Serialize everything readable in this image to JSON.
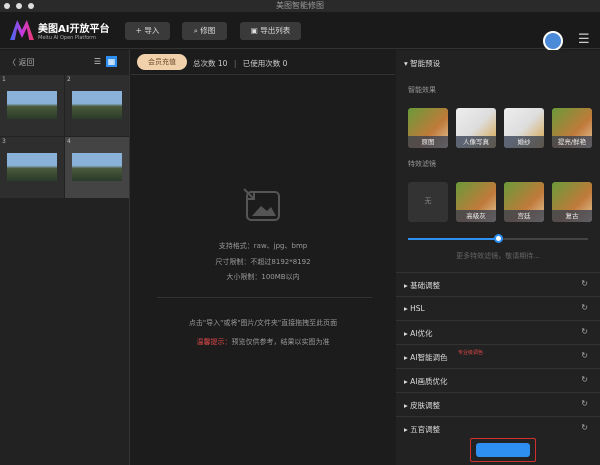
{
  "window": {
    "title": "美图智能修图"
  },
  "header": {
    "brand_title": "美图AI开放平台",
    "brand_subtitle": "Meitu AI Open Platform",
    "import_label": "+ 导入",
    "edit_label": "⌕ 修图",
    "export_list_label": "▣ 导出列表"
  },
  "left": {
    "back_label": "〈 返回",
    "thumbs": [
      {
        "num": "1"
      },
      {
        "num": "2"
      },
      {
        "num": "3"
      },
      {
        "num": "4"
      }
    ]
  },
  "center": {
    "vip_label": "会员充值",
    "total_label": "总次数 10",
    "sep": "|",
    "used_label": "已使用次数 0",
    "format": "支持格式：raw、jpg、bmp",
    "size_limit": "尺寸限制：不超过8192*8192",
    "file_limit": "大小限制：100MB以内",
    "drag_hint": "点击\"导入\"或将\"图片/文件夹\"直接拖拽至此页面",
    "tip_label": "温馨提示：",
    "tip_text": "预览仅供参考，结果以实图为准"
  },
  "right": {
    "preset_title": "智能预设",
    "smart_effects_title": "智能效果",
    "smart_effects": [
      "原图",
      "人像写真",
      "婚纱",
      "提亮/鲜艳"
    ],
    "filters_title": "特效滤镜",
    "filters": [
      "无",
      "高级灰",
      "宫廷",
      "复古"
    ],
    "filter_strength": 0.5,
    "more_filters": "更多特效滤镜，敬请期待...",
    "sections": [
      {
        "label": "基础调整"
      },
      {
        "label": "HSL"
      },
      {
        "label": "AI优化"
      },
      {
        "label": "AI智能调色",
        "badge": "专业级调色"
      },
      {
        "label": "AI画质优化"
      },
      {
        "label": "皮肤调整"
      },
      {
        "label": "五官调整"
      }
    ],
    "reset_icon": "↻"
  },
  "colors": {
    "accent": "#2e8ff0",
    "vip": "#f1d0ac",
    "tip": "#e04848"
  }
}
